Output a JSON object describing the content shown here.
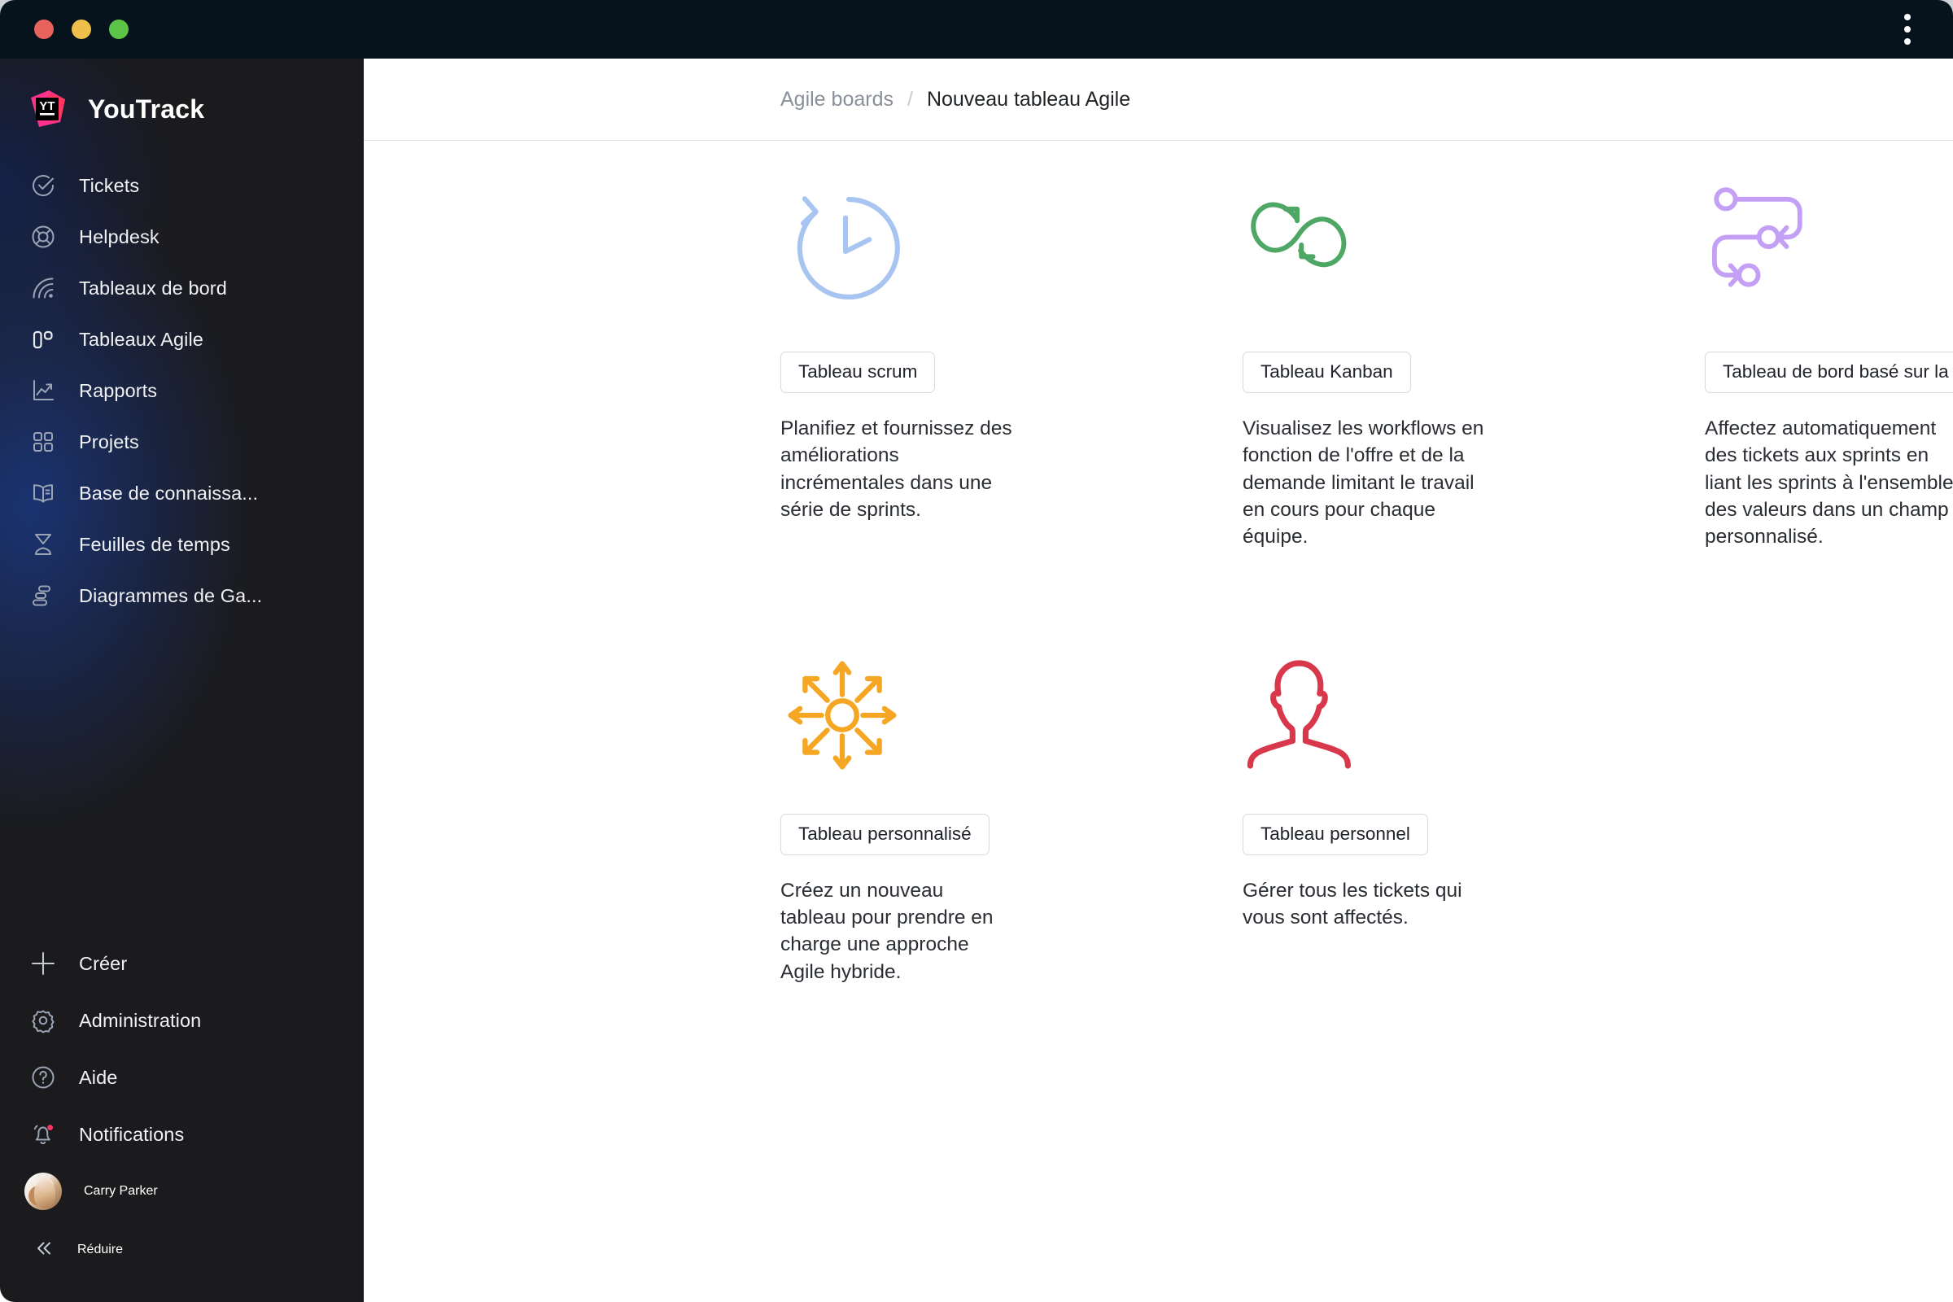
{
  "window": {
    "traffic_lights": [
      "close",
      "minimize",
      "maximize"
    ],
    "menu_icon": "kebab-menu-icon"
  },
  "sidebar": {
    "brand": {
      "name": "YouTrack",
      "logo": "youtrack-logo"
    },
    "items": [
      {
        "label": "Tickets",
        "icon": "check-circle-icon"
      },
      {
        "label": "Helpdesk",
        "icon": "lifebuoy-icon"
      },
      {
        "label": "Tableaux de bord",
        "icon": "dashboard-waves-icon"
      },
      {
        "label": "Tableaux Agile",
        "icon": "agile-board-icon"
      },
      {
        "label": "Rapports",
        "icon": "chart-trend-icon"
      },
      {
        "label": "Projets",
        "icon": "grid-squares-icon"
      },
      {
        "label": "Base de connaissa...",
        "icon": "open-book-icon"
      },
      {
        "label": "Feuilles de temps",
        "icon": "hourglass-icon"
      },
      {
        "label": "Diagrammes de Ga...",
        "icon": "gantt-chart-icon"
      }
    ],
    "bottom_items": [
      {
        "label": "Créer",
        "icon": "plus-icon"
      },
      {
        "label": "Administration",
        "icon": "gear-icon"
      },
      {
        "label": "Aide",
        "icon": "question-circle-icon"
      },
      {
        "label": "Notifications",
        "icon": "bell-icon",
        "badge": true
      }
    ],
    "user": {
      "name": "Carry Parker",
      "avatar": "user-avatar"
    },
    "collapse": {
      "label": "Réduire",
      "icon": "chevron-double-left-icon"
    }
  },
  "breadcrumb": {
    "parent": "Agile boards",
    "separator": "/",
    "current": "Nouveau tableau Agile"
  },
  "board_types": [
    {
      "id": "scrum",
      "button_label": "Tableau scrum",
      "description": "Planifiez et fournissez des améliorations incrémentales dans une série de sprints.",
      "icon": "clock-refresh-icon",
      "color": "#a8c4f0"
    },
    {
      "id": "kanban",
      "button_label": "Tableau Kanban",
      "description": "Visualisez les workflows en fonction de l'offre et de la demande limitant le travail en cours pour chaque équipe.",
      "icon": "infinity-loop-icon",
      "color": "#4fa765"
    },
    {
      "id": "version-based",
      "button_label": "Tableau de bord basé sur la version",
      "description": "Affectez automatiquement des tickets aux sprints en liant les sprints à l'ensemble des valeurs dans un champ personnalisé.",
      "icon": "version-path-icon",
      "color": "#c3a0f5"
    },
    {
      "id": "custom",
      "button_label": "Tableau personnalisé",
      "description": "Créez un nouveau tableau pour prendre en charge une approche Agile hybride.",
      "icon": "sun-arrows-icon",
      "color": "#f5a623"
    },
    {
      "id": "personal",
      "button_label": "Tableau personnel",
      "description": "Gérer tous les tickets qui vous sont affectés.",
      "icon": "person-outline-icon",
      "color": "#d9374b"
    }
  ],
  "colors": {
    "sidebar_bg": "#1b1b1d",
    "sidebar_accent": "#1a3578",
    "titlebar_bg": "#06131c",
    "brand_pink": "#ff318c",
    "notification_badge": "#ff3862"
  }
}
